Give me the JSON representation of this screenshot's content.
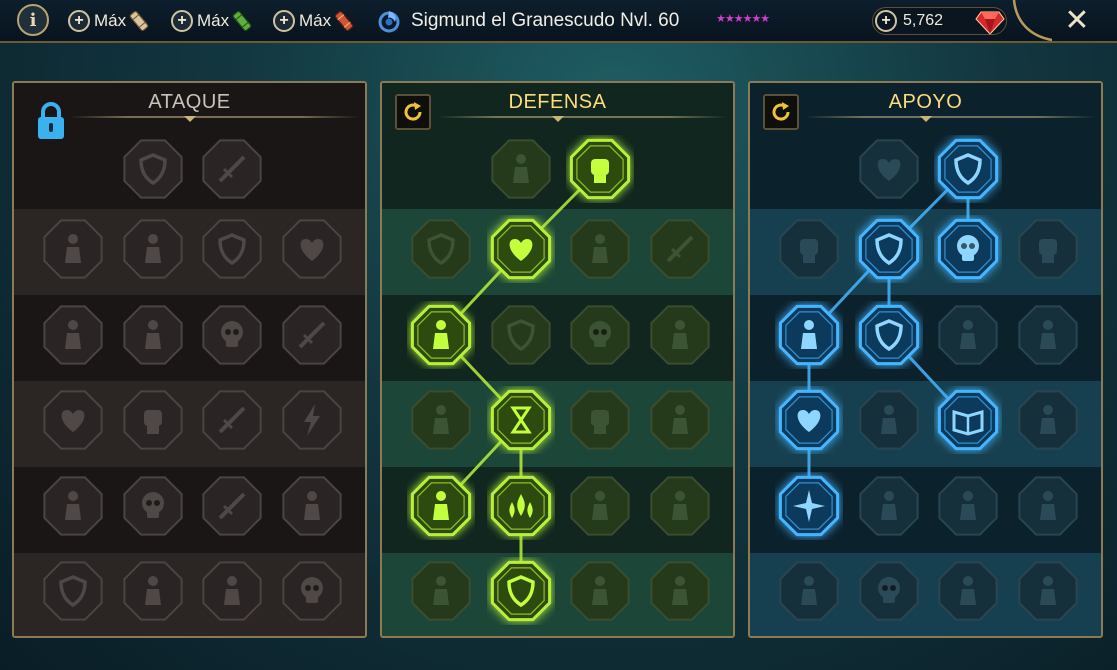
{
  "topbar": {
    "info_label": "i",
    "boosts": [
      {
        "plus": "+",
        "label": "Máx",
        "icon": "tan-scroll-icon"
      },
      {
        "plus": "+",
        "label": "Máx",
        "icon": "green-scroll-icon"
      },
      {
        "plus": "+",
        "label": "Máx",
        "icon": "red-scroll-icon"
      }
    ],
    "champion_name": "Sigmund el Granescudo Nvl. 60",
    "stars": "★★★★★★",
    "gems_plus": "+",
    "gems": "5,762",
    "close_label": "✕"
  },
  "colors": {
    "attack_accent": "#8a8580",
    "defense_accent": "#a6e22e",
    "support_accent": "#3fa9f5",
    "gold": "#ffdb7a",
    "stars": "#d43bd2"
  },
  "panels": {
    "attack": {
      "title": "ATAQUE",
      "locked": true,
      "nodes": [
        [
          {
            "icon": "sword-shield-icon",
            "state": "locked"
          },
          {
            "icon": "claw-slash-icon",
            "state": "locked"
          }
        ],
        [
          {
            "icon": "demon-mask-icon",
            "state": "locked"
          },
          {
            "icon": "cloak-icon",
            "state": "locked"
          },
          {
            "icon": "shield-slash-icon",
            "state": "locked"
          },
          {
            "icon": "pierced-heart-icon",
            "state": "locked"
          }
        ],
        [
          {
            "icon": "strike-burst-icon",
            "state": "locked"
          },
          {
            "icon": "fanged-maw-icon",
            "state": "locked"
          },
          {
            "icon": "skull-icon",
            "state": "locked"
          },
          {
            "icon": "hooked-blade-icon",
            "state": "locked"
          }
        ],
        [
          {
            "icon": "bleeding-heart-icon",
            "state": "locked"
          },
          {
            "icon": "gauntlet-fist-icon",
            "state": "locked"
          },
          {
            "icon": "axe-icon",
            "state": "locked"
          },
          {
            "icon": "lightning-chain-icon",
            "state": "locked"
          }
        ],
        [
          {
            "icon": "spiked-figure-icon",
            "state": "locked"
          },
          {
            "icon": "skull-flame-icon",
            "state": "locked"
          },
          {
            "icon": "circle-sword-icon",
            "state": "locked"
          },
          {
            "icon": "raging-warrior-icon",
            "state": "locked"
          }
        ],
        [
          {
            "icon": "shattered-shield-icon",
            "state": "locked"
          },
          {
            "icon": "knight-helm-icon",
            "state": "locked"
          },
          {
            "icon": "winged-demon-icon",
            "state": "locked"
          },
          {
            "icon": "flaming-skull-icon",
            "state": "locked"
          }
        ]
      ]
    },
    "defense": {
      "title": "DEFENSA",
      "nodes": [
        [
          {
            "icon": "brick-wall-icon",
            "state": "inactive"
          },
          {
            "icon": "raised-fist-icon",
            "state": "active"
          }
        ],
        [
          {
            "icon": "shield-chevron-icon",
            "state": "inactive"
          },
          {
            "icon": "heart-organ-icon",
            "state": "active"
          },
          {
            "icon": "armored-torso-icon",
            "state": "inactive"
          },
          {
            "icon": "broken-blade-icon",
            "state": "inactive"
          }
        ],
        [
          {
            "icon": "guardian-pair-icon",
            "state": "active"
          },
          {
            "icon": "shield-wall-icon",
            "state": "inactive"
          },
          {
            "icon": "skull-shield-icon",
            "state": "inactive"
          },
          {
            "icon": "aura-head-icon",
            "state": "inactive"
          }
        ],
        [
          {
            "icon": "lurking-figure-icon",
            "state": "inactive"
          },
          {
            "icon": "hourglass-burst-icon",
            "state": "active"
          },
          {
            "icon": "open-palm-icon",
            "state": "inactive"
          },
          {
            "icon": "bull-head-icon",
            "state": "inactive"
          }
        ],
        [
          {
            "icon": "dash-runner-icon",
            "state": "active"
          },
          {
            "icon": "triple-drop-icon",
            "state": "active"
          },
          {
            "icon": "warrior-head-icon",
            "state": "inactive"
          },
          {
            "icon": "swirl-icon",
            "state": "inactive"
          }
        ],
        [
          {
            "icon": "horned-face-icon",
            "state": "inactive"
          },
          {
            "icon": "winged-shield-icon",
            "state": "active"
          },
          {
            "icon": "helmed-king-icon",
            "state": "inactive"
          },
          {
            "icon": "strongman-icon",
            "state": "inactive"
          }
        ]
      ]
    },
    "support": {
      "title": "APOYO",
      "nodes": [
        [
          {
            "icon": "heart-plus-icon",
            "state": "inactive"
          },
          {
            "icon": "shield-bash-icon",
            "state": "active"
          }
        ],
        [
          {
            "icon": "praying-hands-icon",
            "state": "inactive"
          },
          {
            "icon": "radiant-shield-icon",
            "state": "active"
          },
          {
            "icon": "spirit-skull-icon",
            "state": "active"
          },
          {
            "icon": "hand-grip-icon",
            "state": "inactive"
          }
        ],
        [
          {
            "icon": "empowered-figure-icon",
            "state": "active"
          },
          {
            "icon": "lightning-shield-icon",
            "state": "active"
          },
          {
            "icon": "whirlwind-icon",
            "state": "inactive"
          },
          {
            "icon": "silhouette-icon",
            "state": "inactive"
          }
        ],
        [
          {
            "icon": "chained-heart-icon",
            "state": "active"
          },
          {
            "icon": "comet-icon",
            "state": "inactive"
          },
          {
            "icon": "open-book-icon",
            "state": "active"
          },
          {
            "icon": "fiery-eyes-icon",
            "state": "inactive"
          }
        ],
        [
          {
            "icon": "compass-star-icon",
            "state": "active"
          },
          {
            "icon": "swift-boot-icon",
            "state": "inactive"
          },
          {
            "icon": "all-seeing-eye-icon",
            "state": "inactive"
          },
          {
            "icon": "leaping-figure-icon",
            "state": "inactive"
          }
        ],
        [
          {
            "icon": "bomb-icon",
            "state": "inactive"
          },
          {
            "icon": "grim-skull-icon",
            "state": "inactive"
          },
          {
            "icon": "iron-helm-icon",
            "state": "inactive"
          },
          {
            "icon": "eagle-head-icon",
            "state": "inactive"
          }
        ]
      ]
    }
  }
}
